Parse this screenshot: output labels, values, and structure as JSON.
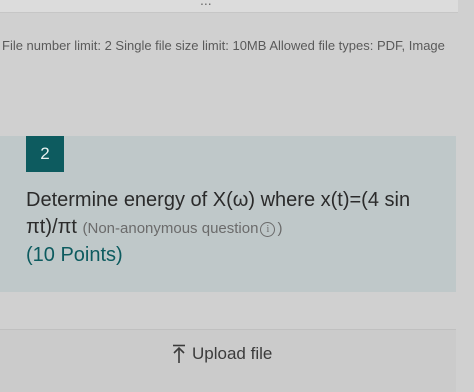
{
  "previous_card": {
    "clipped_text": "..."
  },
  "file_limits": {
    "text": "File number limit: 2   Single file size limit: 10MB   Allowed file types: PDF, Image"
  },
  "question": {
    "number": "2",
    "text": "Determine energy of X(ω) where x(t)=(4 sin πt)/πt",
    "note": "(Non-anonymous question",
    "note_icon": "i",
    "note_close": ")",
    "points": "(10 Points)"
  },
  "upload": {
    "label": "Upload file",
    "icon": "upload-arrow-icon"
  },
  "colors": {
    "accent": "#0d5b5f",
    "question_bg": "#bfc8c9",
    "page_bg": "#d0d0d0"
  }
}
